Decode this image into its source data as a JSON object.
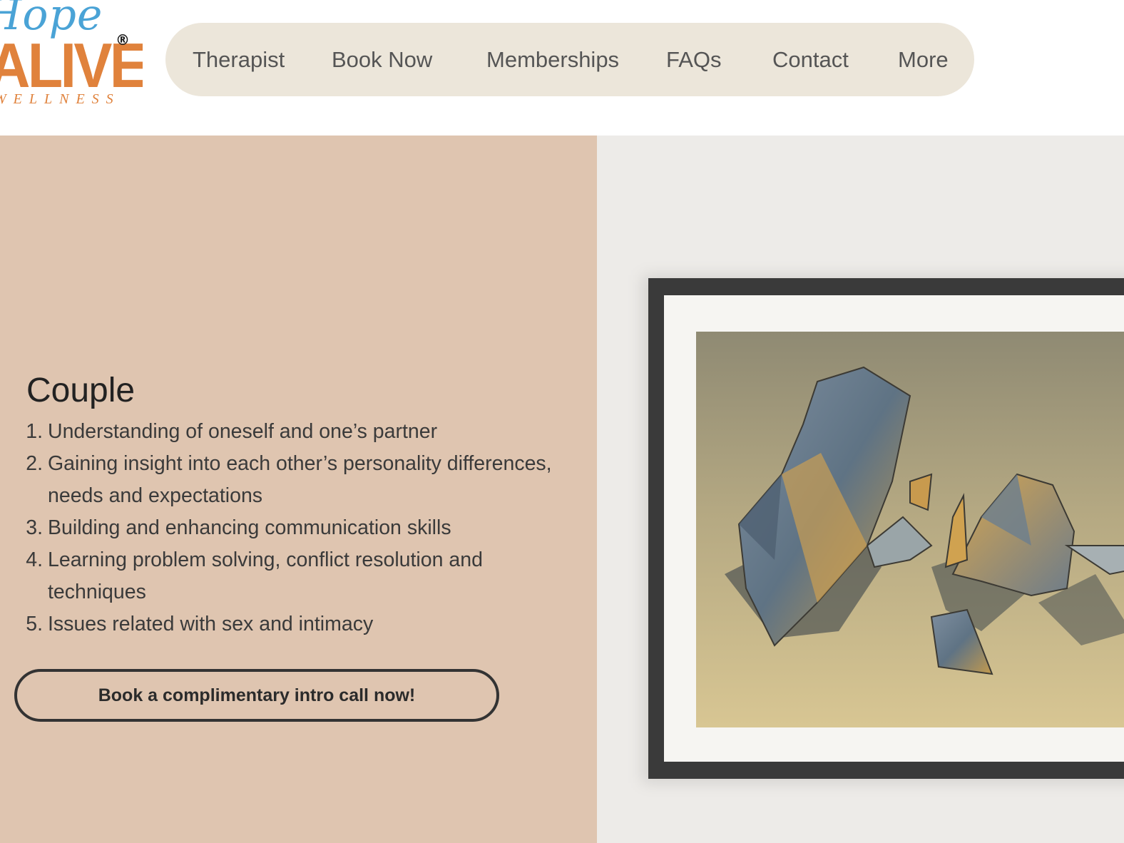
{
  "logo": {
    "script": "Hope",
    "brand": "ALIVE",
    "registered": "®",
    "tagline": "WELLNESS"
  },
  "nav": {
    "items": [
      "Therapist",
      "Book Now",
      "Memberships",
      "FAQs",
      "Contact",
      "More"
    ]
  },
  "section": {
    "heading": "Couple",
    "list": [
      {
        "num": "1.",
        "lines": [
          "Understanding of oneself and one’s partner"
        ]
      },
      {
        "num": "2.",
        "lines": [
          "Gaining insight into each other’s personality differences,",
          "needs and expectations"
        ]
      },
      {
        "num": "3.",
        "lines": [
          "Building and enhancing communication skills"
        ]
      },
      {
        "num": "4.",
        "lines": [
          "Learning problem solving, conflict resolution and",
          "techniques"
        ]
      },
      {
        "num": "5.",
        "lines": [
          "Issues related with sex and intimacy"
        ]
      }
    ],
    "cta_label": "Book a complimentary intro call now!"
  },
  "colors": {
    "left_panel": "#dfc5b0",
    "nav_bg": "#ece6da",
    "brand_orange": "#e0823c",
    "brand_blue": "#4aa3d6"
  }
}
